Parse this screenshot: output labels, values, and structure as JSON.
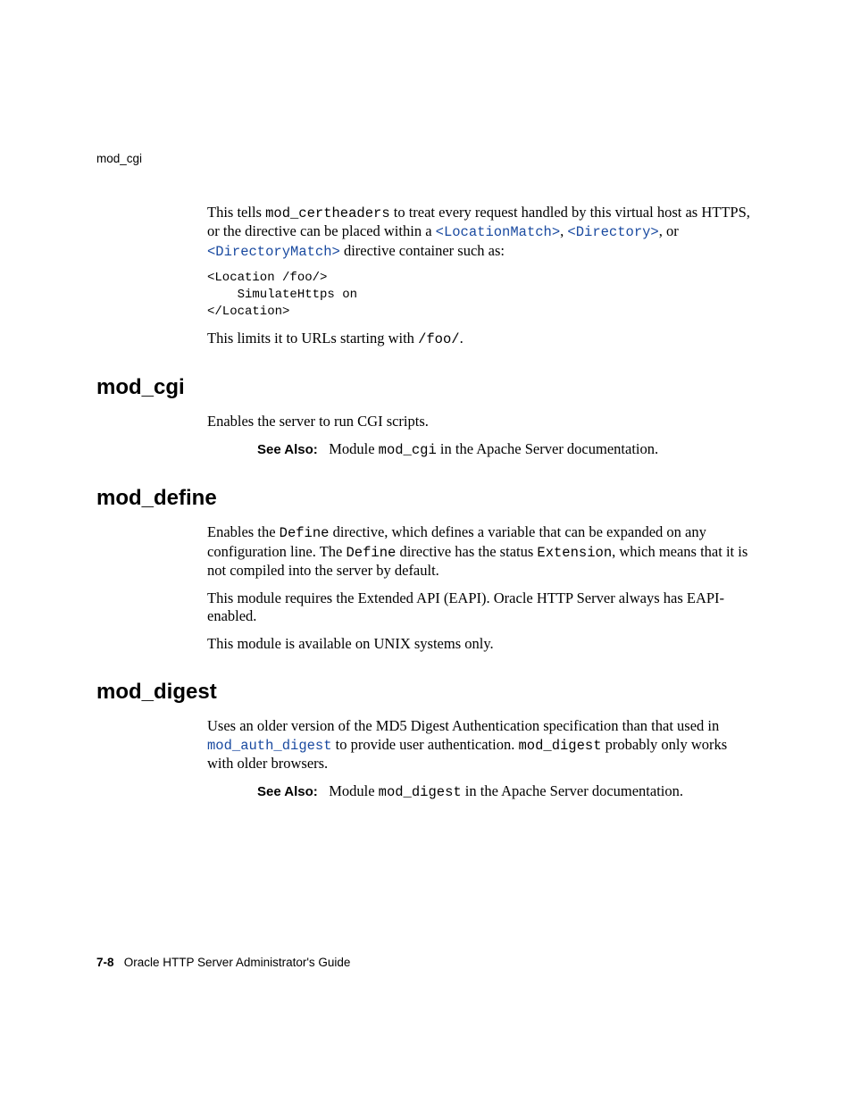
{
  "header": {
    "running": "mod_cgi"
  },
  "intro": {
    "p1_a": "This tells ",
    "p1_code1": "mod_certheaders",
    "p1_b": " to treat every request handled by this virtual host as HTTPS, or the directive can be placed within a ",
    "link1": "<LocationMatch>",
    "p1_c": ", ",
    "link2": "<Directory>",
    "p1_d": ", or ",
    "link3": "<DirectoryMatch>",
    "p1_e": " directive container such as:",
    "code": "<Location /foo/>\n    SimulateHttps on\n</Location>",
    "p2_a": "This limits it to URLs starting with ",
    "p2_code": "/foo/",
    "p2_b": "."
  },
  "sec_cgi": {
    "title": "mod_cgi",
    "p1": "Enables the server to run CGI scripts.",
    "see_label": "See Also:",
    "see_a": "Module ",
    "see_code": "mod_cgi",
    "see_b": " in the Apache Server documentation."
  },
  "sec_define": {
    "title": "mod_define",
    "p1_a": "Enables the ",
    "p1_code1": "Define",
    "p1_b": " directive, which defines a variable that can be expanded on any configuration line. The ",
    "p1_code2": "Define",
    "p1_c": " directive has the status ",
    "p1_code3": "Extension",
    "p1_d": ", which means that it is not compiled into the server by default.",
    "p2": "This module requires the Extended API (EAPI). Oracle HTTP Server always has EAPI-enabled.",
    "p3": "This module is available on UNIX systems only."
  },
  "sec_digest": {
    "title": "mod_digest",
    "p1_a": "Uses an older version of the MD5 Digest Authentication specification than that used in ",
    "p1_link": "mod_auth_digest",
    "p1_b": " to provide user authentication. ",
    "p1_code": "mod_digest",
    "p1_c": " probably only works with older browsers.",
    "see_label": "See Also:",
    "see_a": "Module ",
    "see_code": "mod_digest",
    "see_b": " in the Apache Server documentation."
  },
  "footer": {
    "pageno": "7-8",
    "title": "Oracle HTTP Server Administrator's Guide"
  }
}
